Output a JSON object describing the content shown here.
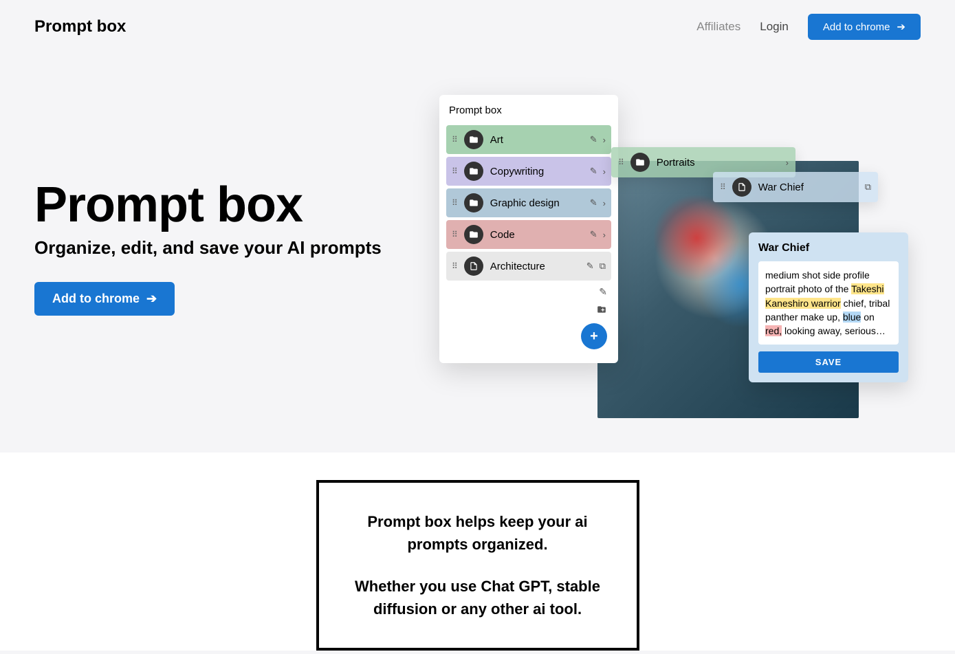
{
  "nav": {
    "logo": "Prompt box",
    "affiliates": "Affiliates",
    "login": "Login",
    "cta": "Add to chrome"
  },
  "hero": {
    "title": "Prompt box",
    "subtitle": "Organize, edit, and save your AI prompts",
    "cta": "Add to chrome"
  },
  "panel": {
    "title": "Prompt box",
    "folders": [
      {
        "label": "Art",
        "color": "green",
        "type": "folder"
      },
      {
        "label": "Copywriting",
        "color": "purple",
        "type": "folder"
      },
      {
        "label": "Graphic design",
        "color": "blue",
        "type": "folder"
      },
      {
        "label": "Code",
        "color": "red",
        "type": "folder"
      },
      {
        "label": "Architecture",
        "color": "grey",
        "type": "doc"
      }
    ]
  },
  "float_folder": {
    "label": "Portraits"
  },
  "float_file": {
    "label": "War Chief"
  },
  "prompt_card": {
    "title": "War Chief",
    "text_pre": "medium shot side profile portrait photo of the ",
    "hl1": "Takeshi Kaneshiro warrior",
    "text_mid": " chief, tribal panther make up, ",
    "hl2": "blue",
    "text_on": " on ",
    "hl3": "red,",
    "text_post": " looking away, serious…",
    "save": "SAVE"
  },
  "section2": {
    "p1": "Prompt box helps keep your ai prompts organized.",
    "p2": "Whether you use Chat GPT, stable diffusion or any other ai tool."
  }
}
